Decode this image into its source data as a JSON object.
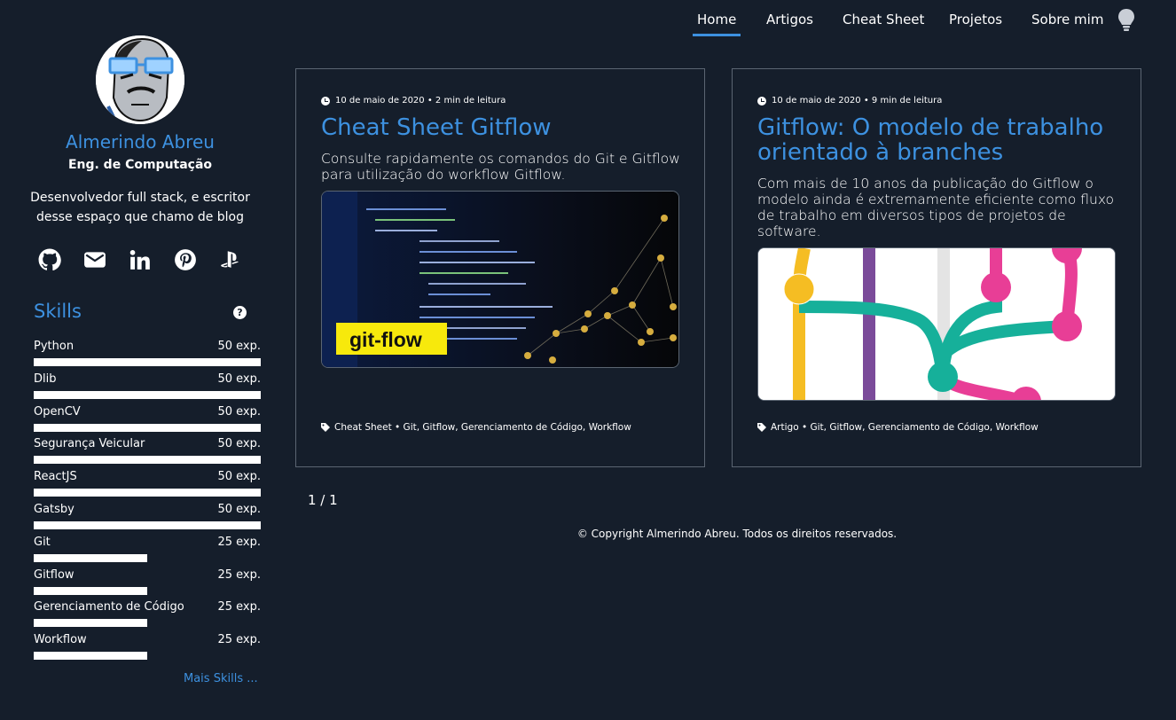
{
  "nav": {
    "items": [
      {
        "label": "Home",
        "active": true
      },
      {
        "label": "Artigos"
      },
      {
        "label": "Cheat Sheet"
      },
      {
        "label": "Projetos"
      },
      {
        "label": "Sobre mim"
      }
    ],
    "theme_icon": "lightbulb-icon"
  },
  "sidebar": {
    "name": "Almerindo Abreu",
    "role": "Eng. de Computação",
    "bio": "Desenvolvedor full stack, e escritor desse espaço que chamo de blog",
    "social": [
      "github-icon",
      "email-icon",
      "linkedin-icon",
      "pinterest-icon",
      "playstation-icon"
    ],
    "skills_title": "Skills",
    "help_label": "?",
    "skills": [
      {
        "name": "Python",
        "exp": "50 exp.",
        "level": 1.0
      },
      {
        "name": "Dlib",
        "exp": "50 exp.",
        "level": 1.0
      },
      {
        "name": "OpenCV",
        "exp": "50 exp.",
        "level": 1.0
      },
      {
        "name": "Segurança Veicular",
        "exp": "50 exp.",
        "level": 1.0
      },
      {
        "name": "ReactJS",
        "exp": "50 exp.",
        "level": 1.0
      },
      {
        "name": "Gatsby",
        "exp": "50 exp.",
        "level": 1.0
      },
      {
        "name": "Git",
        "exp": "25 exp.",
        "level": 0.5
      },
      {
        "name": "Gitflow",
        "exp": "25 exp.",
        "level": 0.5
      },
      {
        "name": "Gerenciamento de Código",
        "exp": "25 exp.",
        "level": 0.5
      },
      {
        "name": "Workflow",
        "exp": "25 exp.",
        "level": 0.5
      }
    ],
    "more_skills": "Mais Skills ..."
  },
  "posts": [
    {
      "meta": "10 de maio de 2020 • 2 min de leitura",
      "title": "Cheat Sheet Gitflow",
      "description": "Consulte rapidamente os comandos do Git e Gitflow para utilização do workflow Gitflow.",
      "image_label": "git-flow",
      "tags": "Cheat Sheet • Git, Gitflow, Gerenciamento de Código, Workflow"
    },
    {
      "meta": "10 de maio de 2020 • 9 min de leitura",
      "title": "Gitflow: O modelo de trabalho orientado à branches",
      "description": "Com mais de 10 anos da publicação do Gitflow o modelo ainda é extremamente eficiente como fluxo de trabalho em diversos tipos de projetos de software.",
      "tags": "Artigo • Git, Gitflow, Gerenciamento de Código, Workflow"
    }
  ],
  "pager": "1 / 1",
  "footer": "© Copyright Almerindo Abreu. Todos os direitos reservados.",
  "colors": {
    "background": "#151e2b",
    "accent": "#3d91e0",
    "border": "#5b6572"
  }
}
